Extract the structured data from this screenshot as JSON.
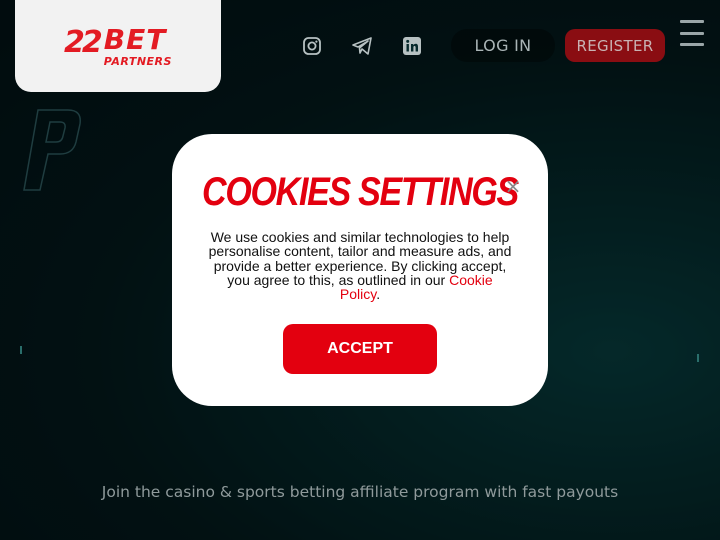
{
  "header": {
    "logo": {
      "mark": "22",
      "brand": "BET",
      "sub": "PARTNERS"
    },
    "social": [
      {
        "icon": "instagram-icon"
      },
      {
        "icon": "telegram-icon"
      },
      {
        "icon": "linkedin-icon"
      }
    ],
    "login_label": "LOG IN",
    "register_label": "REGISTER"
  },
  "hero": {
    "tagline": "Join the casino & sports betting affiliate program with fast payouts"
  },
  "cookie_modal": {
    "title": "COOKIES SETTINGS",
    "body": "We use cookies and similar technologies to help personalise content, tailor and measure ads, and provide a better experience. By clicking accept, you agree to this, as outlined in our",
    "link_text": "Cookie Policy",
    "body_end": ".",
    "accept_label": "ACCEPT",
    "close_glyph": "×"
  },
  "colors": {
    "brand_red": "#e3000f",
    "background": "#041f22"
  }
}
